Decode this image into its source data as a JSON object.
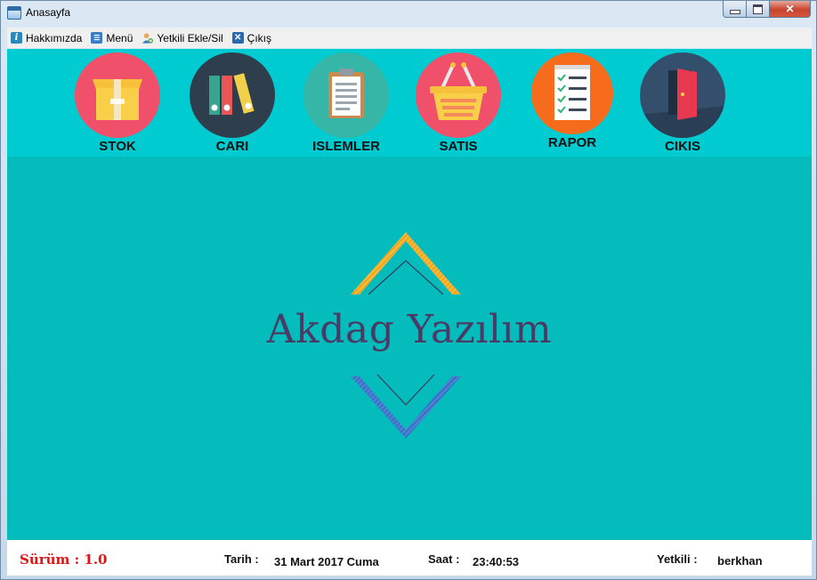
{
  "window": {
    "title": "Anasayfa",
    "min": "_",
    "max": "□",
    "close": "✕"
  },
  "menu": [
    {
      "label": "Hakkımızda",
      "icon": "info-icon"
    },
    {
      "label": "Menü",
      "icon": "menu-icon"
    },
    {
      "label": "Yetkili Ekle/Sil",
      "icon": "user-add-icon"
    },
    {
      "label": "Çıkış",
      "icon": "close-icon"
    }
  ],
  "tiles": [
    {
      "label": "STOK",
      "icon": "box-icon",
      "color": "#f05069"
    },
    {
      "label": "CARI",
      "icon": "binders-icon",
      "color": "#2f3e4d"
    },
    {
      "label": "ISLEMLER",
      "icon": "clipboard-icon",
      "color": "#35b6a6"
    },
    {
      "label": "SATIS",
      "icon": "basket-icon",
      "color": "#f05069"
    },
    {
      "label": "RAPOR",
      "icon": "checklist-icon",
      "color": "#f76b1c"
    },
    {
      "label": "CIKIS",
      "icon": "exit-door-icon",
      "color": "#334f6b"
    }
  ],
  "brand": {
    "name": "Akdag Yazılım"
  },
  "status": {
    "version": "Sürüm : 1.0",
    "date_label": "Tarih :",
    "date_value": "31 Mart 2017 Cuma",
    "time_label": "Saat :",
    "time_value": "23:40:53",
    "user_label": "Yetkili :",
    "user_value": "berkhan"
  },
  "colors": {
    "background": "#04bcbc",
    "topstrip": "#00cbd1",
    "version": "#e01414"
  }
}
